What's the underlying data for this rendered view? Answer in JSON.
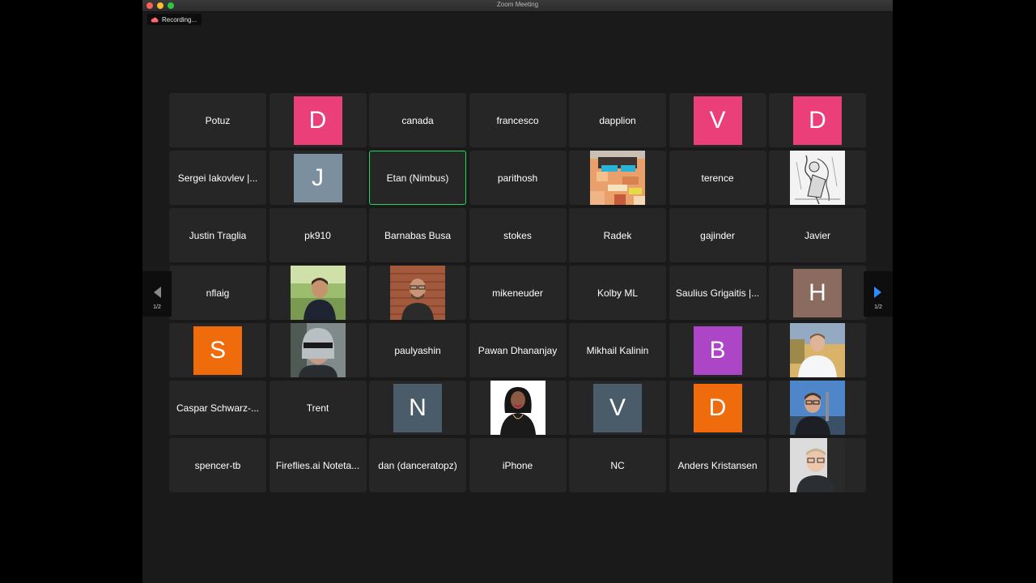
{
  "window": {
    "title": "Zoom Meeting"
  },
  "recording": {
    "label": "Recording..."
  },
  "colors": {
    "pink": "#ea3f79",
    "slate": "#7c8f9e",
    "brown": "#8b6b60",
    "orange": "#ef6b0c",
    "purple": "#ac46c6",
    "darkslate": "#4a5c6a",
    "active_border": "#23d959"
  },
  "participants": [
    {
      "name": "Potuz"
    },
    {
      "initial": "D",
      "color": "#ea3f79"
    },
    {
      "name": "canada"
    },
    {
      "name": "francesco"
    },
    {
      "name": "dapplion"
    },
    {
      "initial": "V",
      "color": "#ea3f79"
    },
    {
      "initial": "D",
      "color": "#ea3f79"
    },
    {
      "name": "Sergei Iakovlev |..."
    },
    {
      "initial": "J",
      "color": "#7c8f9e"
    },
    {
      "name": "Etan (Nimbus)",
      "active": true
    },
    {
      "name": "parithosh"
    },
    {
      "photo": "pixel-art-avatar"
    },
    {
      "name": "terence"
    },
    {
      "photo": "alice-illustration-avatar"
    },
    {
      "name": "Justin Traglia"
    },
    {
      "name": "pk910"
    },
    {
      "name": "Barnabas Busa"
    },
    {
      "name": "stokes"
    },
    {
      "name": "Radek"
    },
    {
      "name": "gajinder"
    },
    {
      "name": "Javier"
    },
    {
      "name": "nflaig"
    },
    {
      "photo": "man-outdoors-avatar"
    },
    {
      "photo": "man-brick-wall-avatar"
    },
    {
      "name": "mikeneuder"
    },
    {
      "name": "Kolby ML"
    },
    {
      "name": "Saulius Grigaitis |..."
    },
    {
      "initial": "H",
      "color": "#8b6b60"
    },
    {
      "initial": "S",
      "color": "#ef6b0c"
    },
    {
      "photo": "robocop-avatar"
    },
    {
      "name": "paulyashin"
    },
    {
      "name": "Pawan Dhananjay"
    },
    {
      "name": "Mikhail Kalinin"
    },
    {
      "initial": "B",
      "color": "#ac46c6"
    },
    {
      "photo": "man-white-shirt-avatar"
    },
    {
      "name": "Caspar Schwarz-..."
    },
    {
      "name": "Trent"
    },
    {
      "initial": "N",
      "color": "#4a5c6a"
    },
    {
      "photo": "woman-portrait-avatar"
    },
    {
      "initial": "V",
      "color": "#4a5c6a"
    },
    {
      "initial": "D",
      "color": "#ef6b0c"
    },
    {
      "photo": "man-blue-sky-avatar"
    },
    {
      "name": "spencer-tb"
    },
    {
      "name": "Fireflies.ai Noteta..."
    },
    {
      "name": "dan (danceratopz)"
    },
    {
      "name": "iPhone"
    },
    {
      "name": "NC"
    },
    {
      "name": "Anders Kristansen"
    },
    {
      "photo": "man-glasses-avatar"
    }
  ],
  "pagination": {
    "left_label": "1/2",
    "right_label": "1/2",
    "left_arrow_color": "#8a8a8a",
    "right_arrow_color": "#2d8cff"
  }
}
